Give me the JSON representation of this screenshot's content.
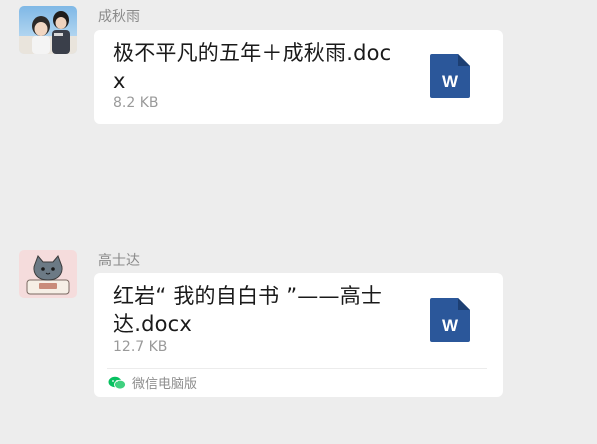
{
  "messages": [
    {
      "sender": "成秋雨",
      "avatar": "photo-avatar",
      "file": {
        "name": "极不平凡的五年＋成秋雨.docx",
        "size": "8.2 KB",
        "icon": "word-document-icon",
        "icon_letter": "W"
      }
    },
    {
      "sender": "高士达",
      "avatar": "cartoon-cat-avatar",
      "file": {
        "name": "红岩“ 我的自白书 ”——高士达.docx",
        "size": "12.7 KB",
        "icon": "word-document-icon",
        "icon_letter": "W"
      },
      "source": {
        "label": "微信电脑版",
        "icon": "wechat-icon"
      }
    }
  ],
  "colors": {
    "background": "#ededed",
    "bubble": "#ffffff",
    "word_blue": "#2b579a",
    "wechat_green": "#07c160"
  }
}
